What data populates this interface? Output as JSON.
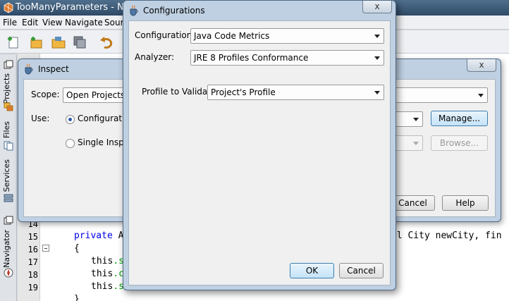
{
  "main_window": {
    "title": "TooManyParameters - NetBe",
    "menu": [
      "File",
      "Edit",
      "View",
      "Navigate",
      "Sour"
    ],
    "toolbar_icons": [
      "new-file-icon",
      "new-project-icon",
      "open-project-icon",
      "save-all-icon",
      "undo-icon"
    ],
    "side_tabs": [
      "Projects",
      "Files",
      "Services",
      "Navigator"
    ]
  },
  "editor": {
    "line_numbers": [
      "14",
      "15",
      "16",
      "17",
      "18",
      "19"
    ],
    "lines": {
      "l14_kw": "private",
      "l14_rest": " A",
      "l14_tail": "al City newCity, fin",
      "l15": "{",
      "l16_kw": "this",
      "l16_fld": ".s",
      "l17_kw": "this",
      "l17_fld": ".c",
      "l18_kw": "this",
      "l18_fld": ".s",
      "l19": "}"
    }
  },
  "inspect_dialog": {
    "title": "Inspect",
    "close_label": "x",
    "scope_label": "Scope:",
    "scope_value": "Open Projects",
    "use_label": "Use:",
    "configuration_radio": "Configuratio",
    "single_radio": "Single Inspect",
    "manage_button": "Manage...",
    "browse_button": "Browse...",
    "cancel_button": "Cancel",
    "help_button": "Help"
  },
  "config_dialog": {
    "title": "Configurations",
    "close_label": "x",
    "configurations_label": "Configurations:",
    "configurations_value": "Java Code Metrics",
    "analyzer_label": "Analyzer:",
    "analyzer_value": "JRE 8 Profiles Conformance",
    "profile_label": "Profile to Validate:",
    "profile_value": "Project's Profile",
    "ok_button": "OK",
    "cancel_button": "Cancel"
  },
  "colors": {
    "titlebar": "#2f4a66",
    "dialog_frame": "#bfd0e2",
    "keyword": "#0000e6",
    "field": "#009900",
    "focus_button": "#c4e3f8"
  }
}
